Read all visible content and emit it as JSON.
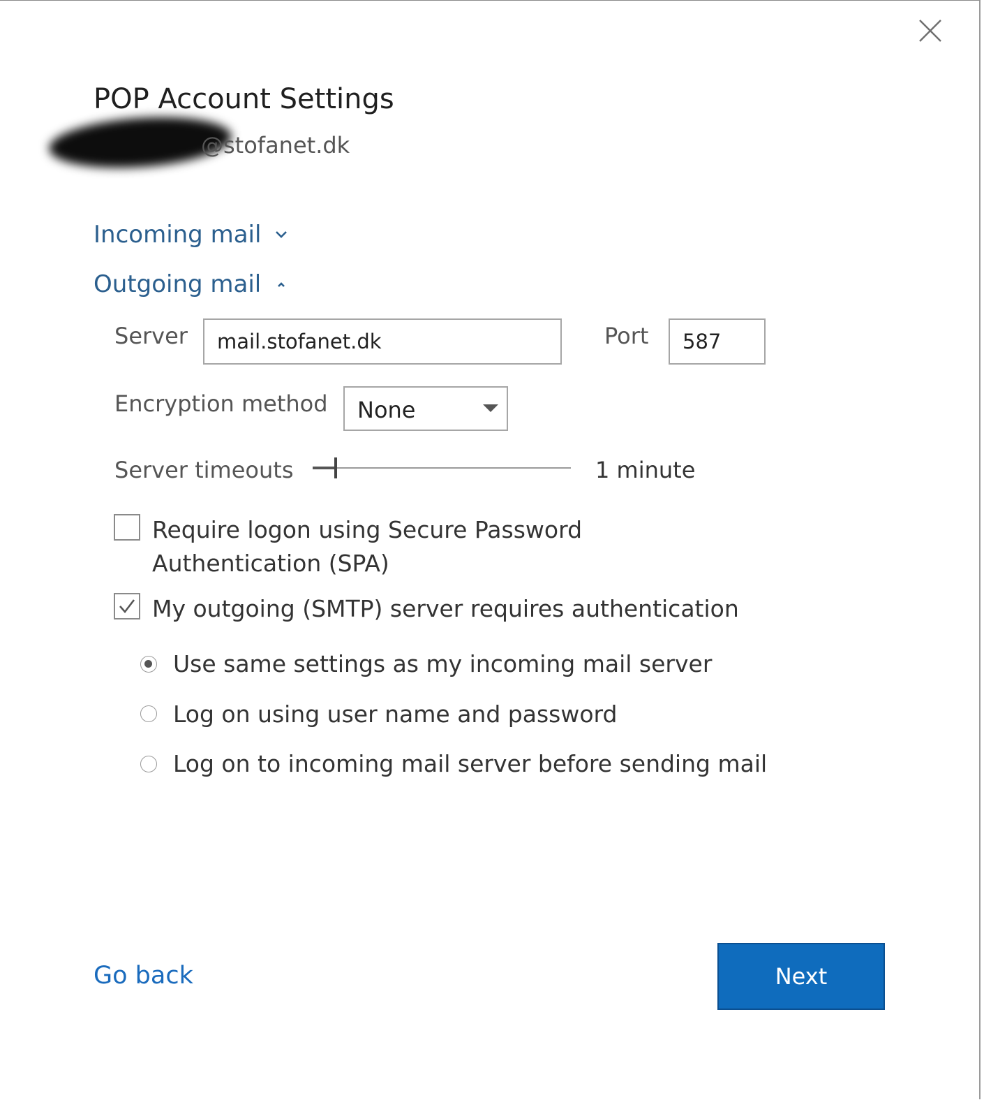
{
  "dialog": {
    "title": "POP Account Settings",
    "account_domain": "@stofanet.dk",
    "close_icon": "close-icon"
  },
  "sections": {
    "incoming_label": "Incoming mail",
    "incoming_icon": "chevron-down-icon",
    "outgoing_label": "Outgoing mail",
    "outgoing_icon": "chevron-up-icon"
  },
  "outgoing": {
    "server_label": "Server",
    "server_value": "mail.stofanet.dk",
    "port_label": "Port",
    "port_value": "587",
    "encryption_label": "Encryption method",
    "encryption_value": "None",
    "timeouts_label": "Server timeouts",
    "timeouts_value_text": "1 minute",
    "timeouts_level": 0.09,
    "spa_label": "Require logon using Secure Password Authentication (SPA)",
    "spa_checked": false,
    "smtp_auth_label": "My outgoing (SMTP) server requires authentication",
    "smtp_auth_checked": true,
    "auth_options": [
      {
        "label": "Use same settings as my incoming mail server",
        "selected": true
      },
      {
        "label": "Log on using user name and password",
        "selected": false
      },
      {
        "label": "Log on to incoming mail server before sending mail",
        "selected": false
      }
    ]
  },
  "footer": {
    "go_back_label": "Go back",
    "next_label": "Next"
  },
  "colors": {
    "accent": "#0f6cbd",
    "section_link": "#2b5f8e",
    "text": "#333333"
  }
}
